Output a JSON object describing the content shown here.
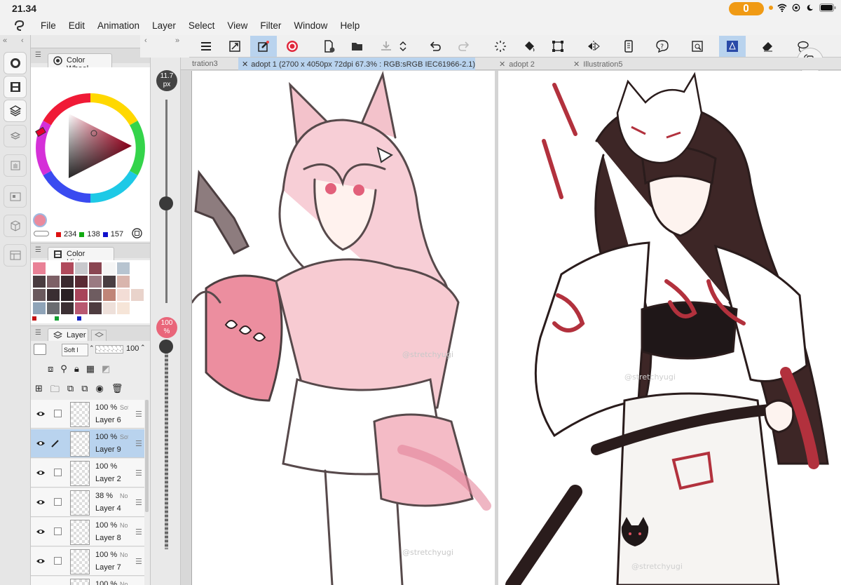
{
  "status": {
    "time": "21.34"
  },
  "menu": [
    "File",
    "Edit",
    "Animation",
    "Layer",
    "Select",
    "View",
    "Filter",
    "Window",
    "Help"
  ],
  "panels": {
    "color_wheel": {
      "title": "Color Wheel",
      "r": "234",
      "g": "138",
      "b": "157",
      "current_color": "#ea8a9d"
    },
    "color_history": {
      "title": "Color History",
      "swatches": [
        "#e98196",
        "#ffffff",
        "#b04a5c",
        "#c8c8cc",
        "#8a4652",
        "#f5f5f5",
        "#b7c4d0",
        "#ffffff",
        "#4a3c40",
        "#7d6066",
        "#3b2a30",
        "#5a2a34",
        "#9a7a82",
        "#4a3e42",
        "#d9b5ad",
        "#ffffff",
        "#6a5a5e",
        "#3a2e32",
        "#2a2024",
        "#a8445a",
        "#6e5c60",
        "#c08578",
        "#f3ddd6",
        "#e9d3cb",
        "#8fa4b8",
        "#6a6c70",
        "#3c3034",
        "#b85870",
        "#4e3c40",
        "#eee0da",
        "#f6e5d8",
        "#ffffff"
      ]
    },
    "layer": {
      "title": "Layer",
      "blend": "Soft l",
      "opacity": "100",
      "layers": [
        {
          "opacity": "100 %",
          "mode": "Sof",
          "name": "Layer 6",
          "selected": false
        },
        {
          "opacity": "100 %",
          "mode": "Sof",
          "name": "Layer 9",
          "selected": true
        },
        {
          "opacity": "100 %",
          "mode": "",
          "name": "Layer 2",
          "selected": false
        },
        {
          "opacity": "38 %",
          "mode": "Norm",
          "name": "Layer 4",
          "selected": false
        },
        {
          "opacity": "100 %",
          "mode": "No",
          "name": "Layer 8",
          "selected": false
        },
        {
          "opacity": "100 %",
          "mode": "No",
          "name": "Layer 7",
          "selected": false
        },
        {
          "opacity": "100 %",
          "mode": "No",
          "name": "",
          "selected": false
        }
      ]
    }
  },
  "brush": {
    "size": "11.7",
    "size_unit": "px",
    "opacity": "100",
    "opacity_unit": "%"
  },
  "tabs": {
    "partial": "tration3",
    "active": "adopt 1  (2700 x 4050px 72dpi 67.3% : RGB:sRGB IEC61966-2.1)",
    "second": "adopt 2",
    "third": "Illustration5"
  },
  "watermark": "@stretchyugi",
  "colors": {
    "accent": "#b9d3ee",
    "pink": "#ea8a9d",
    "red": "#b2313d"
  }
}
